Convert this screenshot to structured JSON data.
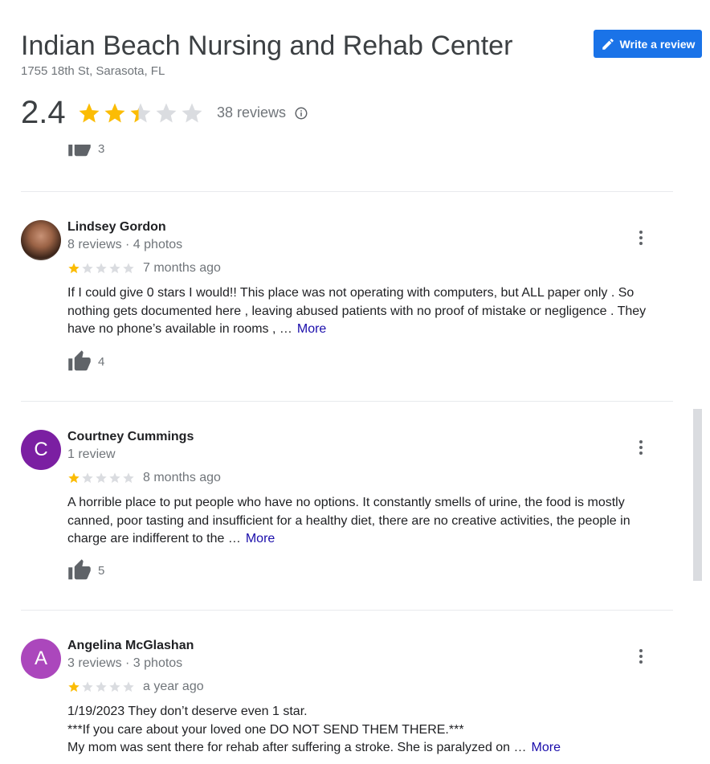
{
  "header": {
    "title": "Indian Beach Nursing and Rehab Center",
    "address": "1755 18th St, Sarasota, FL",
    "write_review_label": "Write a review",
    "rating": "2.4",
    "rating_stars": 2.4,
    "review_count": "38 reviews",
    "star_color": "#fbbc04"
  },
  "partial_review": {
    "likes": "3"
  },
  "reviews": [
    {
      "name": "Lindsey Gordon",
      "meta": "8 reviews · 4 photos",
      "stars": 1,
      "date": "7 months ago",
      "text": "If I could give 0 stars I would!! This place was not operating with computers, but ALL paper only . So nothing gets documented here , leaving abused patients with no proof of mistake or negligence . They have no phone’s available in rooms , …",
      "more": "More",
      "likes": "4",
      "avatar": "photo"
    },
    {
      "name": "Courtney Cummings",
      "meta": "1 review",
      "stars": 1,
      "date": "8 months ago",
      "text": "A horrible place to put people who have no options. It constantly smells of urine, the food is mostly canned, poor tasting and insufficient for a healthy diet, there are no creative activities, the people in charge are indifferent to the …",
      "more": "More",
      "likes": "5",
      "avatar": "C",
      "avatar_color": "#7b1fa2"
    },
    {
      "name": "Angelina McGlashan",
      "meta": "3 reviews · 3 photos",
      "stars": 1,
      "date": "a year ago",
      "text_lines": [
        "1/19/2023 They don’t deserve even 1 star.",
        "***If you care about your loved one DO NOT SEND THEM THERE.***",
        "My mom was sent there for rehab after suffering a stroke. She is paralyzed on …"
      ],
      "more": "More",
      "avatar": "A",
      "avatar_color": "#ab47bc"
    }
  ]
}
